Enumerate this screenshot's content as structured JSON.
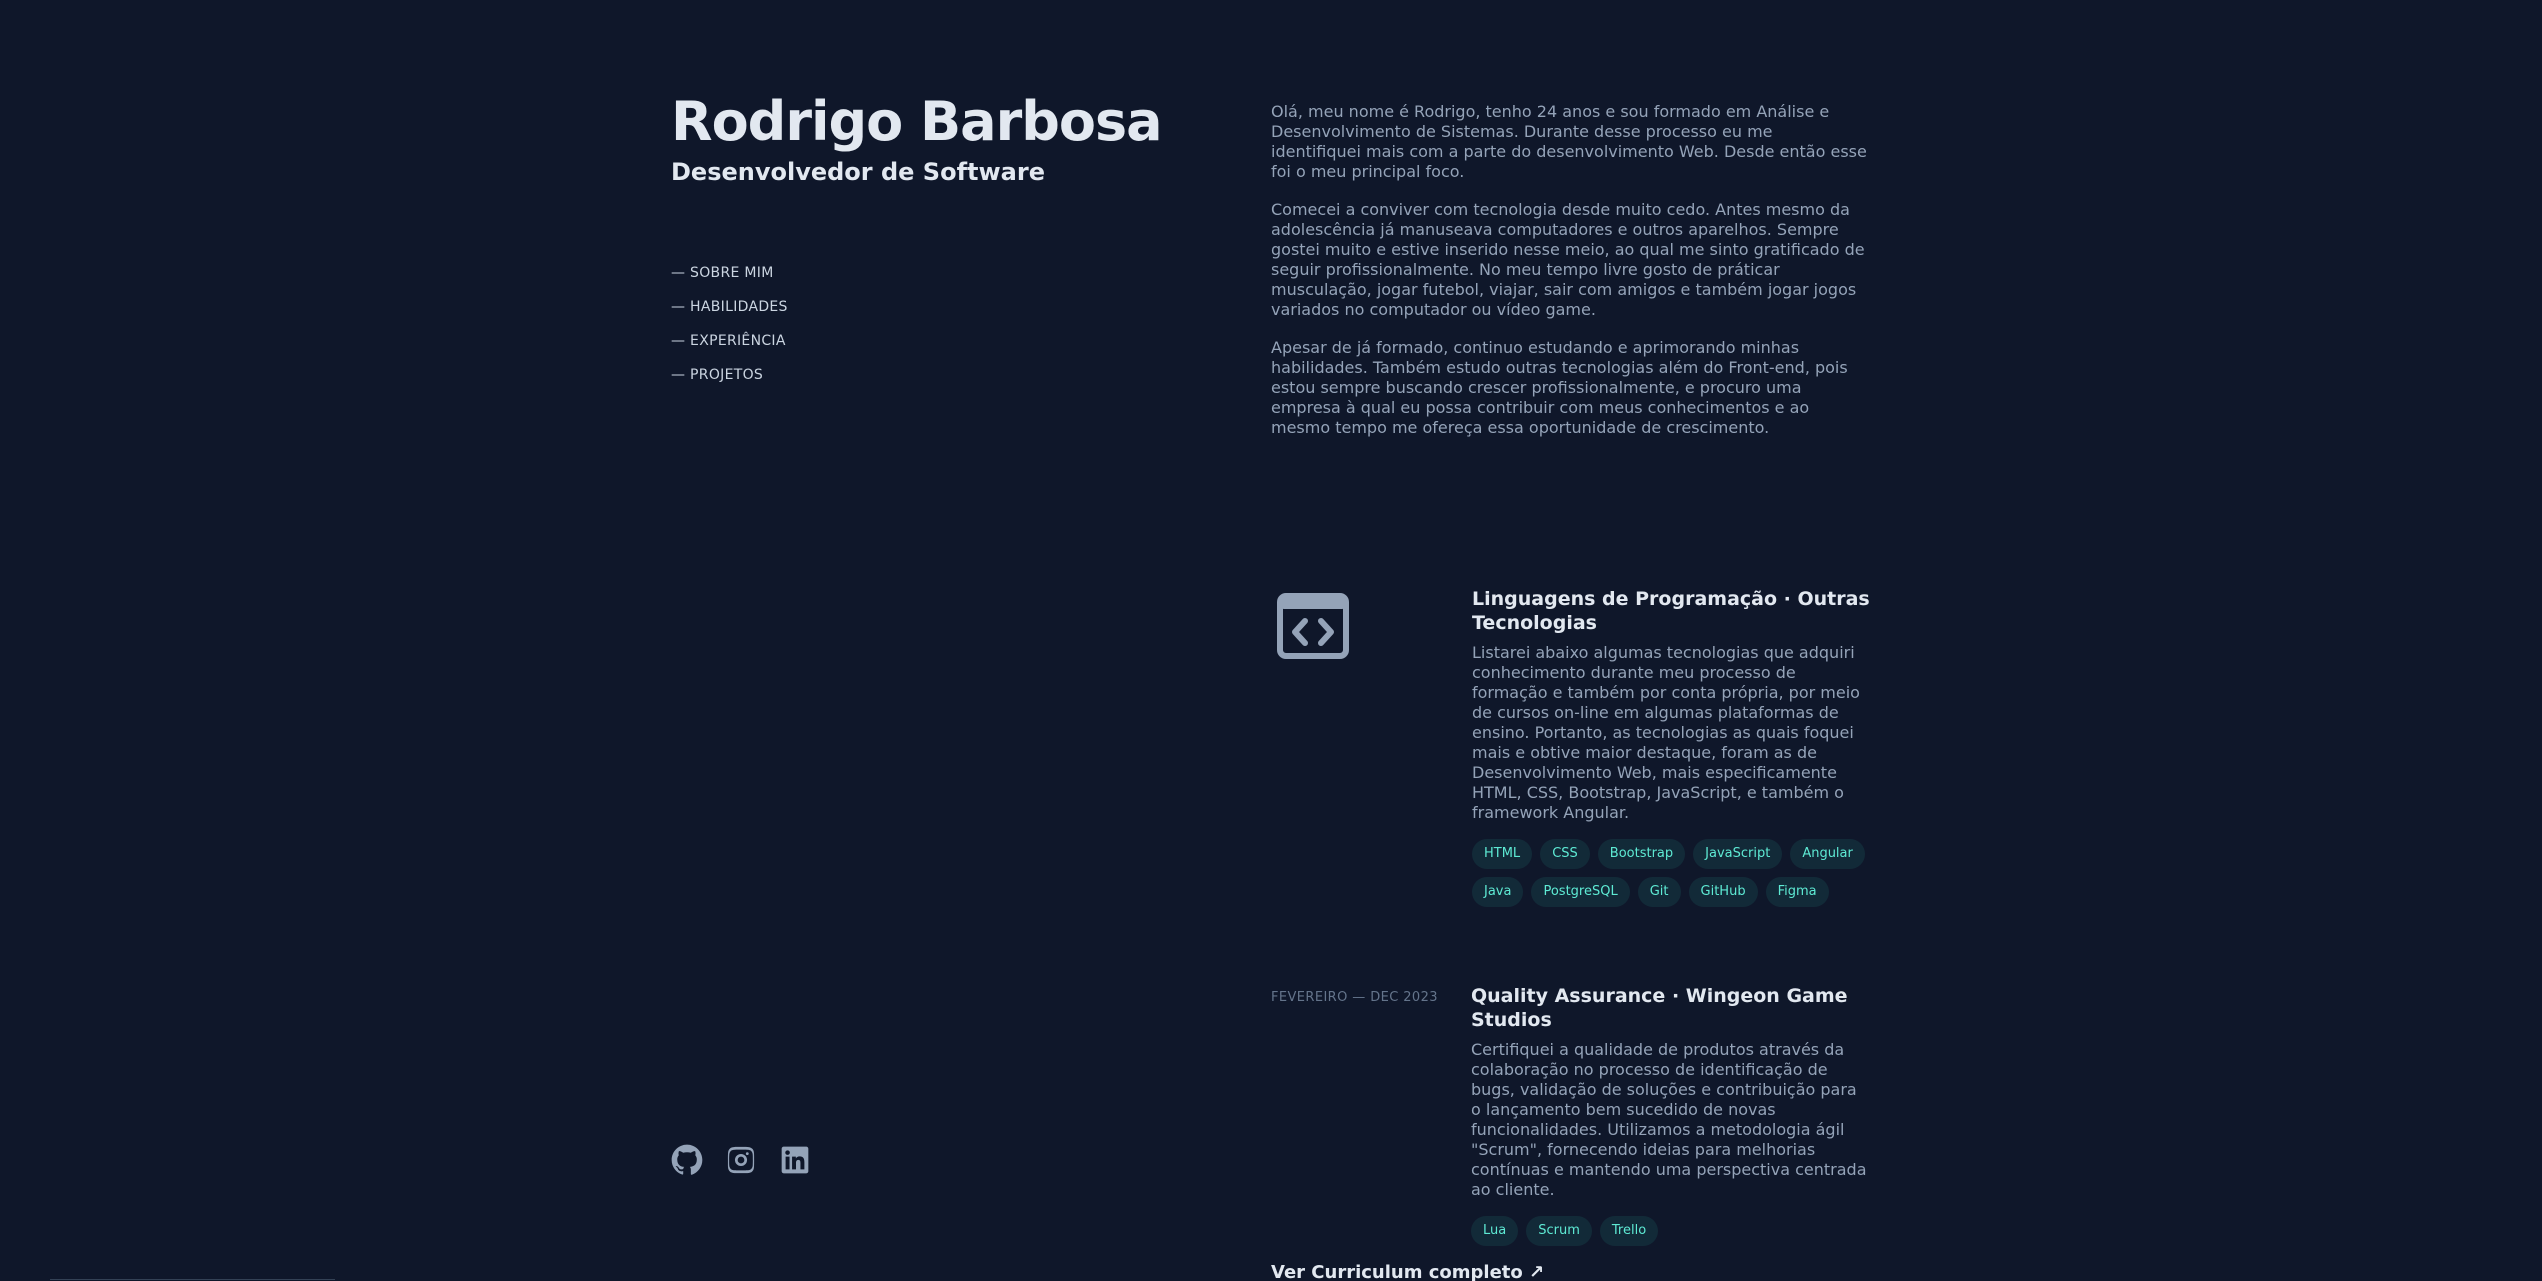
{
  "header": {
    "name": "Rodrigo Barbosa",
    "role": "Desenvolvedor de Software"
  },
  "nav": {
    "items": [
      {
        "label": "— SOBRE MIM"
      },
      {
        "label": "— HABILIDADES"
      },
      {
        "label": "— EXPERIÊNCIA"
      },
      {
        "label": "— PROJETOS"
      }
    ]
  },
  "socials": {
    "items": [
      {
        "icon": "github-icon"
      },
      {
        "icon": "instagram-icon"
      },
      {
        "icon": "linkedin-icon"
      }
    ]
  },
  "about": {
    "paragraphs": [
      "Olá, meu nome é Rodrigo, tenho 24 anos e sou formado em Análise e Desenvolvimento de Sistemas. Durante desse processo eu me identifiquei mais com a parte do desenvolvimento Web. Desde então esse foi o meu principal foco.",
      "Comecei a conviver com tecnologia desde muito cedo. Antes mesmo da adolescência já manuseava computadores e outros aparelhos. Sempre gostei muito e estive inserido nesse meio, ao qual me sinto gratificado de seguir profissionalmente. No meu tempo livre gosto de práticar musculação, jogar futebol, viajar, sair com amigos e também jogar jogos variados no computador ou vídeo game.",
      "Apesar de já formado, continuo estudando e aprimorando minhas habilidades. Também estudo outras tecnologias além do Front-end, pois estou sempre buscando crescer profissionalmente, e procuro uma empresa à qual eu possa contribuir com meus conhecimentos e ao mesmo tempo me ofereça essa oportunidade de crescimento."
    ]
  },
  "skills": {
    "icon": "code-window-icon",
    "title": "Linguagens de Programação · Outras Tecnologias",
    "description": "Listarei abaixo algumas tecnologias que adquiri conhecimento durante meu processo de formação e também por conta própria, por meio de cursos on-line em algumas plataformas de ensino. Portanto, as tecnologias as quais foquei mais e obtive maior destaque, foram as de Desenvolvimento Web, mais especificamente HTML, CSS, Bootstrap, JavaScript, e também o framework Angular.",
    "tags": [
      "HTML",
      "CSS",
      "Bootstrap",
      "JavaScript",
      "Angular",
      "Java",
      "PostgreSQL",
      "Git",
      "GitHub",
      "Figma"
    ]
  },
  "experience": {
    "period": "FEVEREIRO — DEC 2023",
    "title": "Quality Assurance · Wingeon Game Studios",
    "description": "Certifiquei a qualidade de produtos através da colaboração no processo de identificação de bugs, validação de soluções e contribuição para o lançamento bem sucedido de novas funcionalidades. Utilizamos a metodologia ágil \"Scrum\", fornecendo ideias para melhorias contínuas e mantendo uma perspectiva centrada ao cliente.",
    "tags": [
      "Lua",
      "Scrum",
      "Trello"
    ]
  },
  "resume": {
    "label": "Ver Curriculum completo ↗"
  },
  "colors": {
    "background": "#0f172a",
    "heading": "#e2e8f0",
    "text": "#94a3b8",
    "tag_text": "#5eead4"
  }
}
